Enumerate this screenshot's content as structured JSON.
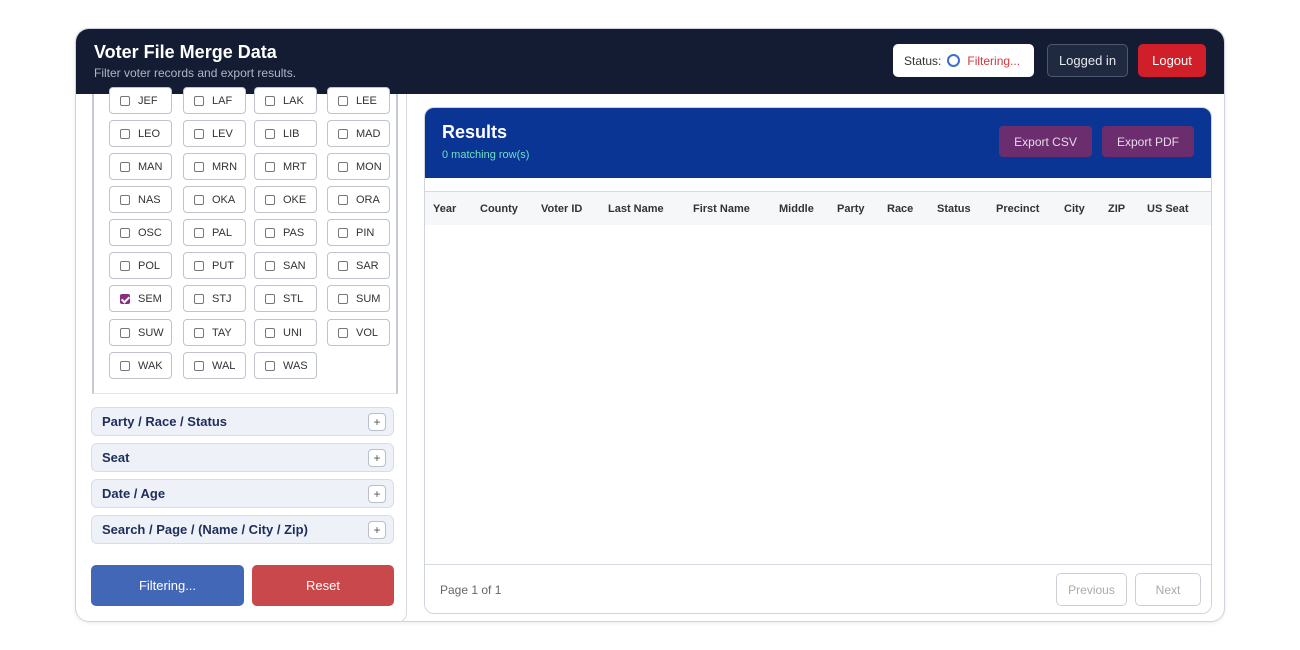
{
  "header": {
    "title": "Voter File Merge Data",
    "subtitle": "Filter voter records and export results.",
    "status_label": "Status:",
    "status_value": "Filtering...",
    "logged_in_label": "Logged in",
    "logout_label": "Logout"
  },
  "counties": [
    {
      "code": "JEF",
      "checked": false
    },
    {
      "code": "LAF",
      "checked": false
    },
    {
      "code": "LAK",
      "checked": false
    },
    {
      "code": "LEE",
      "checked": false
    },
    {
      "code": "LEO",
      "checked": false
    },
    {
      "code": "LEV",
      "checked": false
    },
    {
      "code": "LIB",
      "checked": false
    },
    {
      "code": "MAD",
      "checked": false
    },
    {
      "code": "MAN",
      "checked": false
    },
    {
      "code": "MRN",
      "checked": false
    },
    {
      "code": "MRT",
      "checked": false
    },
    {
      "code": "MON",
      "checked": false
    },
    {
      "code": "NAS",
      "checked": false
    },
    {
      "code": "OKA",
      "checked": false
    },
    {
      "code": "OKE",
      "checked": false
    },
    {
      "code": "ORA",
      "checked": false
    },
    {
      "code": "OSC",
      "checked": false
    },
    {
      "code": "PAL",
      "checked": false
    },
    {
      "code": "PAS",
      "checked": false
    },
    {
      "code": "PIN",
      "checked": false
    },
    {
      "code": "POL",
      "checked": false
    },
    {
      "code": "PUT",
      "checked": false
    },
    {
      "code": "SAN",
      "checked": false
    },
    {
      "code": "SAR",
      "checked": false
    },
    {
      "code": "SEM",
      "checked": true
    },
    {
      "code": "STJ",
      "checked": false
    },
    {
      "code": "STL",
      "checked": false
    },
    {
      "code": "SUM",
      "checked": false
    },
    {
      "code": "SUW",
      "checked": false
    },
    {
      "code": "TAY",
      "checked": false
    },
    {
      "code": "UNI",
      "checked": false
    },
    {
      "code": "VOL",
      "checked": false
    },
    {
      "code": "WAK",
      "checked": false
    },
    {
      "code": "WAL",
      "checked": false
    },
    {
      "code": "WAS",
      "checked": false
    }
  ],
  "accordions": [
    {
      "label": "Party / Race / Status",
      "icon": "+"
    },
    {
      "label": "Seat",
      "icon": "+"
    },
    {
      "label": "Date / Age",
      "icon": "+"
    },
    {
      "label": "Search / Page / (Name / City / Zip)",
      "icon": "+"
    }
  ],
  "actions": {
    "filter_label": "Filtering...",
    "reset_label": "Reset"
  },
  "results": {
    "title": "Results",
    "count": "0 matching row(s)",
    "export_csv": "Export CSV",
    "export_pdf": "Export PDF",
    "columns": [
      "Year",
      "County",
      "Voter ID",
      "Last Name",
      "First Name",
      "Middle",
      "Party",
      "Race",
      "Status",
      "Precinct",
      "City",
      "ZIP",
      "US Seat"
    ],
    "rows": [],
    "page_info": "Page 1 of 1",
    "previous_label": "Previous",
    "next_label": "Next"
  },
  "colors": {
    "header_bg": "#131c33",
    "results_header_bg": "#0b3594",
    "export_button": "#6b2d6e",
    "logout_button": "#d11f2a",
    "filter_button": "#4267b6",
    "reset_button": "#c9484b",
    "checked": "#8a2b84"
  }
}
